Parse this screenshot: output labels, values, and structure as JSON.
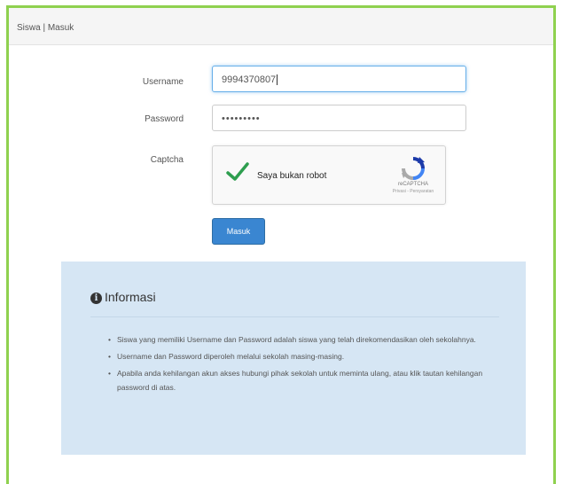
{
  "header": {
    "title": "Siswa | Masuk"
  },
  "form": {
    "username": {
      "label": "Username",
      "value": "9994370807"
    },
    "password": {
      "label": "Password",
      "masked_value": "•••••••••"
    },
    "captcha": {
      "label": "Captcha",
      "checkbox_text": "Saya bukan robot",
      "checked": true,
      "brand": "reCAPTCHA",
      "links": "Privasi - Persyaratan"
    },
    "submit_label": "Masuk"
  },
  "info": {
    "title": "Informasi",
    "items": [
      "Siswa yang memiliki Username dan Password adalah siswa yang telah direkomendasikan oleh sekolahnya.",
      "Username dan Password diperoleh melalui sekolah masing-masing.",
      "Apabila anda kehilangan akun akses hubungi pihak sekolah untuk meminta ulang, atau klik tautan kehilangan password di atas."
    ]
  },
  "colors": {
    "frame_border": "#8fd14f",
    "button": "#3a86d1",
    "info_bg": "#d6e6f4",
    "check": "#2e9e4f"
  }
}
